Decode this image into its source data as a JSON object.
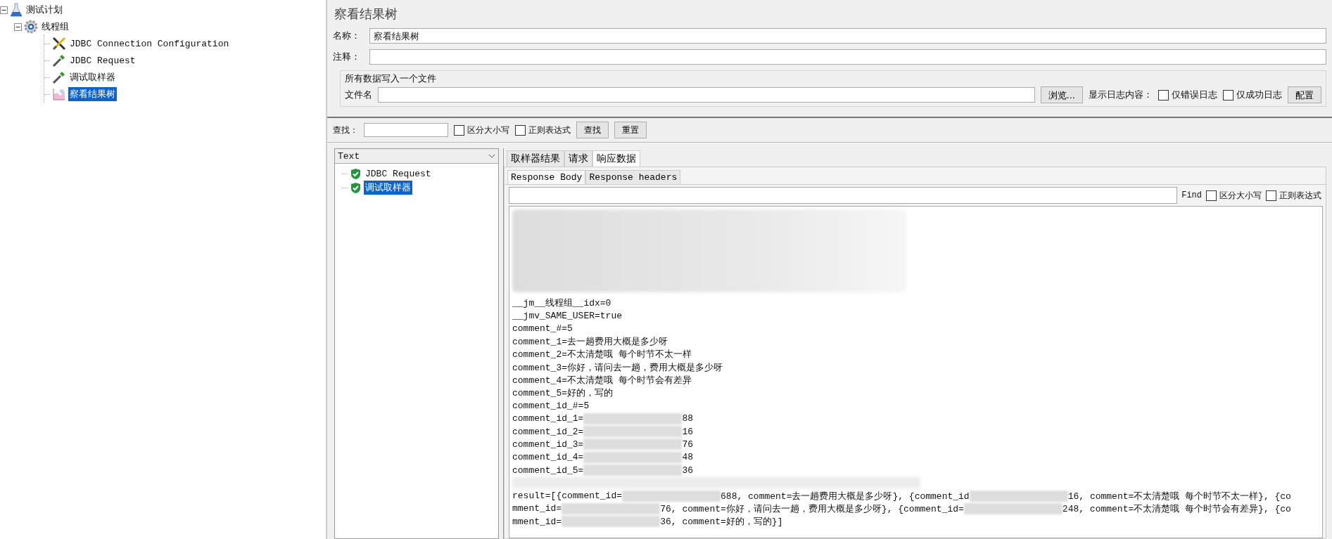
{
  "tree": {
    "label": "测试计划",
    "kind": "plan",
    "expanded": true,
    "selected": false,
    "children": [
      {
        "label": "线程组",
        "kind": "threadgroup",
        "expanded": true,
        "selected": false,
        "children": [
          {
            "label": "JDBC Connection Configuration",
            "kind": "config",
            "selected": false
          },
          {
            "label": "JDBC Request",
            "kind": "sampler",
            "selected": false
          },
          {
            "label": "调试取样器",
            "kind": "sampler",
            "selected": false
          },
          {
            "label": "察看结果树",
            "kind": "listener",
            "selected": true
          }
        ]
      }
    ]
  },
  "title": "察看结果树",
  "name_field": {
    "label": "名称：",
    "value": "察看结果树"
  },
  "comment_field": {
    "label": "注释："
  },
  "file_group": {
    "title": "所有数据写入一个文件",
    "file_label": "文件名",
    "browse_button": "浏览...",
    "log_label": "显示日志内容：",
    "checkboxes": [
      {
        "label": "仅错误日志",
        "checked": false
      },
      {
        "label": "仅成功日志",
        "checked": false
      }
    ],
    "config_button": "配置"
  },
  "search": {
    "label": "查找：",
    "checkboxes": [
      {
        "label": "区分大小写",
        "checked": false
      },
      {
        "label": "正则表达式",
        "checked": false
      }
    ],
    "buttons": [
      "查找",
      "重置"
    ]
  },
  "renderer_select": {
    "value": "Text"
  },
  "results": [
    {
      "label": "JDBC Request",
      "selected": false
    },
    {
      "label": "调试取样器",
      "selected": true
    }
  ],
  "tabs": [
    {
      "label": "取样器结果",
      "selected": false
    },
    {
      "label": "请求",
      "selected": false
    },
    {
      "label": "响应数据",
      "selected": true
    }
  ],
  "subtabs": [
    {
      "label": "Response Body",
      "selected": true
    },
    {
      "label": "Response headers",
      "selected": false
    }
  ],
  "find_bar": {
    "label": "Find",
    "checkboxes": [
      {
        "label": "区分大小写",
        "checked": false
      },
      {
        "label": "正则表达式",
        "checked": false
      }
    ]
  },
  "body_lines": [
    {
      "parts": [
        "__jm__线程组__idx=0"
      ]
    },
    {
      "parts": [
        "__jmv_SAME_USER=true"
      ]
    },
    {
      "parts": [
        "comment_#=5"
      ]
    },
    {
      "parts": [
        "comment_1=去一趟费用大概是多少呀"
      ]
    },
    {
      "parts": [
        "comment_2=不太清楚哦 每个时节不太一样"
      ]
    },
    {
      "parts": [
        "comment_3=你好，请问去一趟，费用大概是多少呀"
      ]
    },
    {
      "parts": [
        "comment_4=不太清楚哦 每个时节会有差异"
      ]
    },
    {
      "parts": [
        "comment_5=好的，写的"
      ]
    },
    {
      "parts": [
        "comment_id_#=5"
      ]
    },
    {
      "parts": [
        "comment_id_1=",
        "88"
      ]
    },
    {
      "parts": [
        "comment_id_2=",
        "16"
      ]
    },
    {
      "parts": [
        "comment_id_3=",
        "76"
      ]
    },
    {
      "parts": [
        "comment_id_4=",
        "48"
      ]
    },
    {
      "parts": [
        "comment_id_5=",
        "36"
      ]
    },
    {
      "kind": "blurred"
    },
    {
      "parts": [
        "result=[{comment_id=",
        "688, comment=去一趟费用大概是多少呀}, {comment_id",
        "16, comment=不太清楚哦 每个时节不太一样}, {co"
      ]
    },
    {
      "parts": [
        "mment_id=",
        "76, comment=你好，请问去一趟，费用大概是多少呀}, {comment_id=",
        "248, comment=不太清楚哦 每个时节会有差异}, {co"
      ]
    },
    {
      "parts": [
        "mment_id=",
        "36, comment=好的，写的}]"
      ]
    }
  ]
}
